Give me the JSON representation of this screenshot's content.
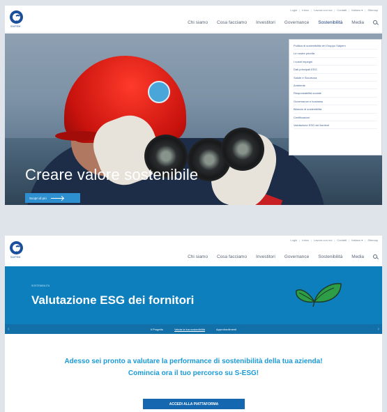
{
  "screenshot_1": {
    "util_links": [
      "Login",
      "Inbox",
      "Lavora con noi",
      "Contatti",
      "Italiano ▾",
      "Sitemap"
    ],
    "logo_text": "SAIPEM",
    "nav": [
      "Chi siamo",
      "Cosa facciamo",
      "Investitori",
      "Governance",
      "Sostenibilità",
      "Media"
    ],
    "nav_active": "Sostenibilità",
    "dropdown": [
      "Politica di sostenibilità del Gruppo Saipem",
      "Le nostre priorità",
      "I nostri impegni",
      "Dati principali ESG",
      "Salute e Sicurezza",
      "Ambiente",
      "Responsabilità sociale",
      "Governance e business",
      "Bilancio di sostenibilità",
      "Certificazioni",
      "Valutazione ESG dei fornitori"
    ],
    "hero_title": "Creare valore sostenibile",
    "hero_button": "Scopri di più"
  },
  "screenshot_2": {
    "util_links": [
      "Login",
      "Inbox",
      "Lavora con noi",
      "Contatti",
      "Italiano ▾",
      "Sitemap"
    ],
    "logo_text": "SAIPEM",
    "nav": [
      "Chi siamo",
      "Cosa facciamo",
      "Investitori",
      "Governance",
      "Sostenibilità",
      "Media"
    ],
    "eyebrow": "SOSTENIBILITÀ",
    "title": "Valutazione ESG dei fornitori",
    "subnav": [
      "Il Progetto",
      "Valuta la tua sostenibilità",
      "Approfondimenti"
    ],
    "message_line_1": "Adesso sei pronto a valutare la performance di sostenibilità della tua azienda!",
    "message_line_2": "Comincia ora il tuo percorso su S-ESG!",
    "cta": "ACCEDI ALLA PIATTAFORMA"
  },
  "colors": {
    "page_bg": "#dfe3ea",
    "brand_blue": "#1b4f9c",
    "band_blue": "#0e7fbd",
    "message_blue": "#1a9ad6",
    "cta_blue": "#1567b0",
    "helmet_red": "#d31a12",
    "leaf_green": "#2e9e46"
  },
  "icons": [
    "logo-icon",
    "search-icon",
    "arrow-right-icon",
    "leaf-icon",
    "chevron-left-icon",
    "chevron-right-icon"
  ]
}
